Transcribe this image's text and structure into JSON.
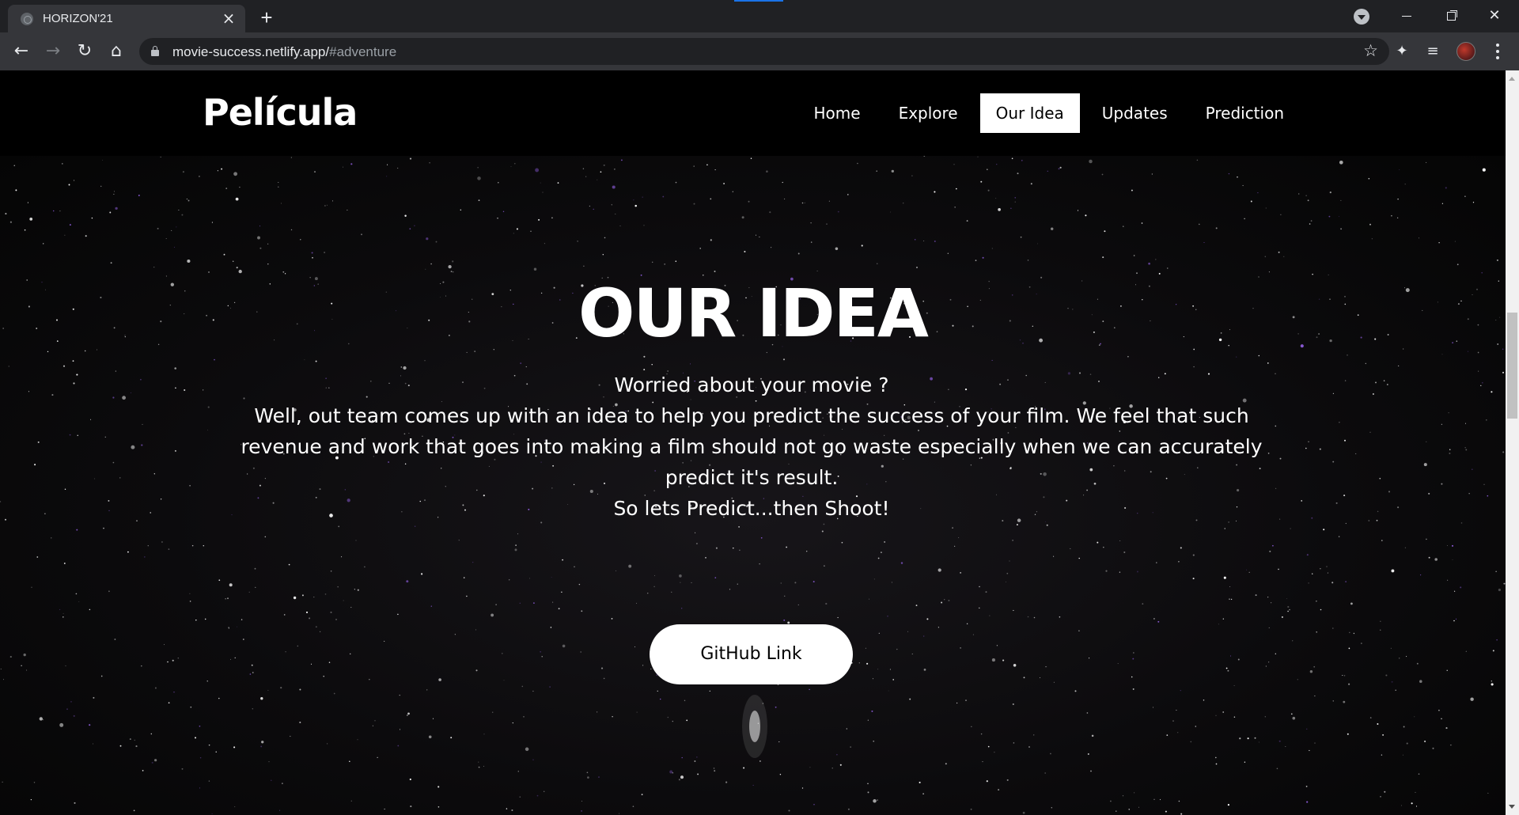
{
  "browser": {
    "tab_title": "HORIZON'21",
    "url_host": "movie-success.netlify.app/",
    "url_hash": "#adventure"
  },
  "site": {
    "brand": "Película",
    "nav": [
      "Home",
      "Explore",
      "Our Idea",
      "Updates",
      "Prediction"
    ],
    "active_nav": "Our Idea"
  },
  "hero": {
    "title": "OUR IDEA",
    "line1": "Worried about your movie ?",
    "line2": "Well, out team comes up with an idea to help you predict the success of your film. We feel that such revenue and work that goes into making a film should not go waste especially when we can accurately predict it's result.",
    "line3": "So lets Predict...then Shoot!",
    "button": "GitHub Link"
  },
  "colors": {
    "header_bg": "#000000",
    "active_nav_bg": "#ffffff",
    "button_bg": "#ffffff"
  }
}
